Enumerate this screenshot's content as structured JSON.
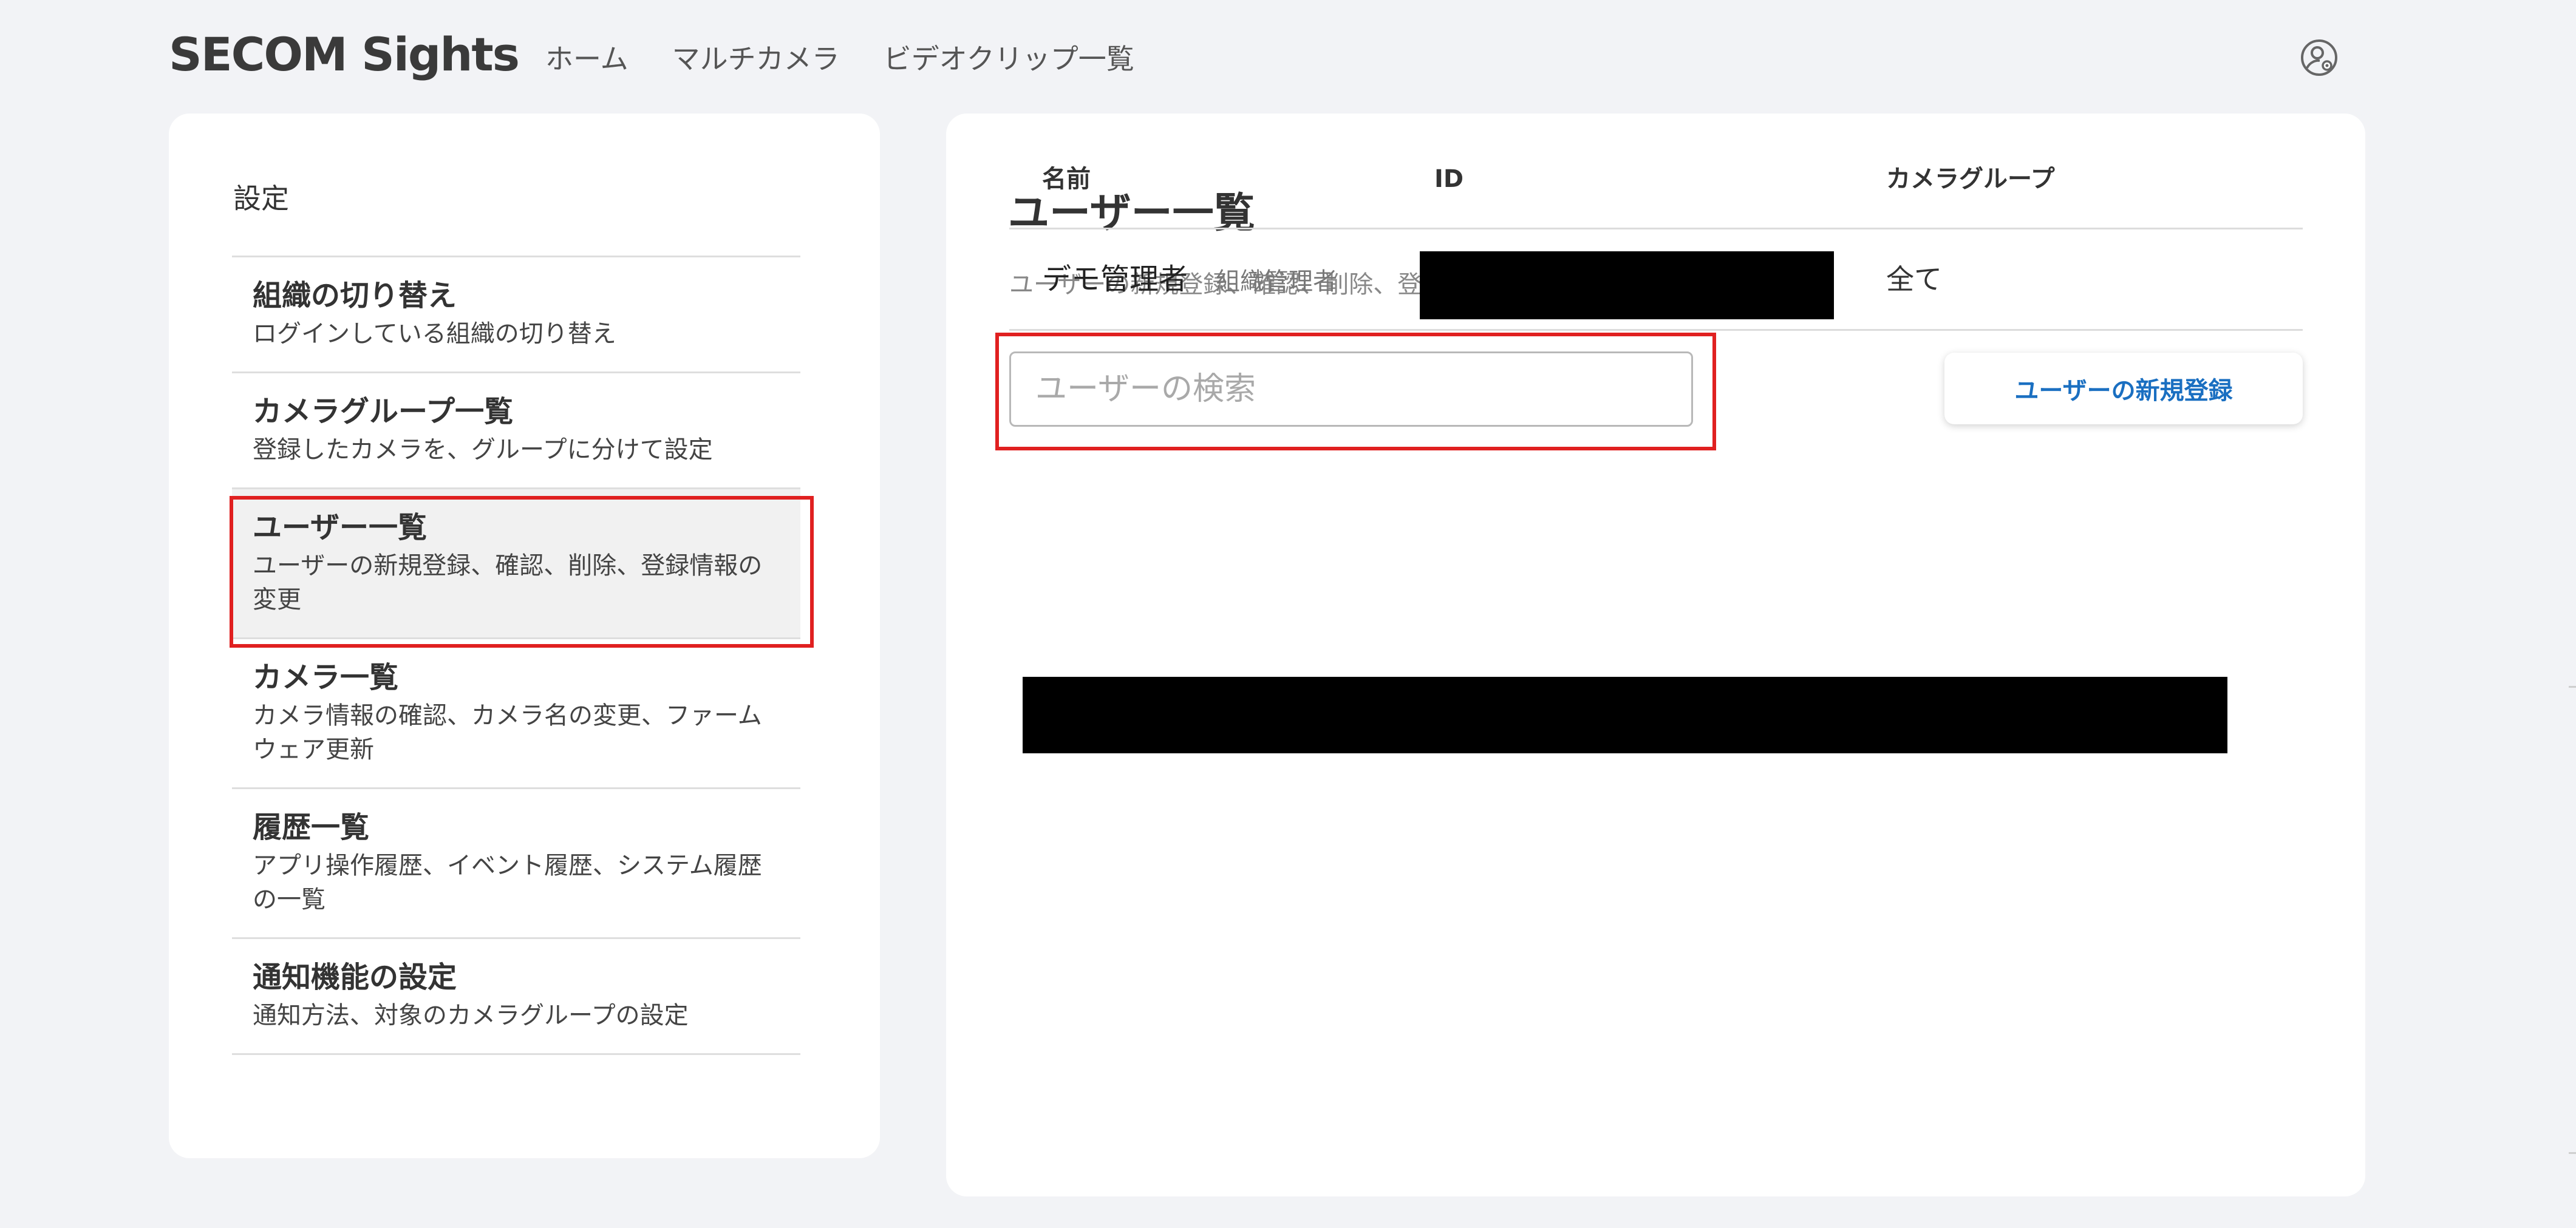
{
  "app": {
    "logo_text": "SECOM Sights"
  },
  "nav": {
    "items": [
      {
        "label": "ホーム"
      },
      {
        "label": "マルチカメラ"
      },
      {
        "label": "ビデオクリップ一覧"
      }
    ]
  },
  "header": {
    "account_icon": "account-gear-icon"
  },
  "sidebar": {
    "title": "設定",
    "items": [
      {
        "title": "組織の切り替え",
        "desc": "ログインしている組織の切り替え",
        "active": false
      },
      {
        "title": "カメラグループ一覧",
        "desc": "登録したカメラを、グループに分けて設定",
        "active": false
      },
      {
        "title": "ユーザー一覧",
        "desc": "ユーザーの新規登録、確認、削除、登録情報の変更",
        "active": true
      },
      {
        "title": "カメラ一覧",
        "desc": "カメラ情報の確認、カメラ名の変更、ファームウェア更新",
        "active": false
      },
      {
        "title": "履歴一覧",
        "desc": "アプリ操作履歴、イベント履歴、システム履歴の一覧",
        "active": false
      },
      {
        "title": "通知機能の設定",
        "desc": "通知方法、対象のカメラグループの設定",
        "active": false
      }
    ]
  },
  "main": {
    "title": "ユーザー一覧",
    "subtitle": "ユーザーの新規登録、確認、削除、登録情報の変更",
    "search": {
      "placeholder": "ユーザーの検索",
      "value": ""
    },
    "add_button_label": "ユーザーの新規登録",
    "table": {
      "columns": [
        "名前",
        "ID",
        "カメラグループ"
      ],
      "rows": [
        {
          "name": "デモ管理者",
          "role": "組織管理者",
          "id": "",
          "camera_group": "全て"
        }
      ]
    }
  },
  "colors": {
    "background": "#f2f3f6",
    "card": "#ffffff",
    "accent": "#1a6fc1",
    "highlight": "#e02020",
    "redaction": "#000000"
  }
}
